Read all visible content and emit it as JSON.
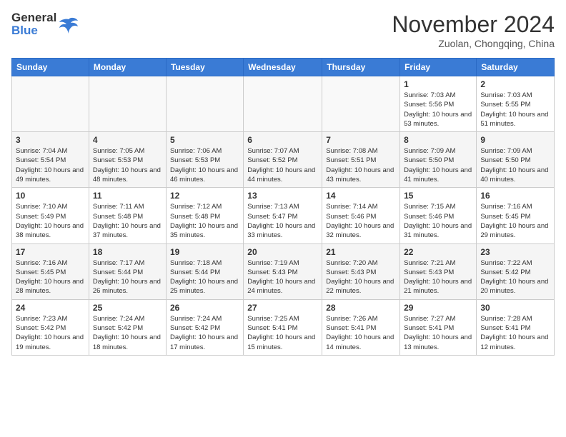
{
  "header": {
    "logo_line1": "General",
    "logo_line2": "Blue",
    "month": "November 2024",
    "location": "Zuolan, Chongqing, China"
  },
  "weekdays": [
    "Sunday",
    "Monday",
    "Tuesday",
    "Wednesday",
    "Thursday",
    "Friday",
    "Saturday"
  ],
  "weeks": [
    [
      {
        "day": "",
        "info": ""
      },
      {
        "day": "",
        "info": ""
      },
      {
        "day": "",
        "info": ""
      },
      {
        "day": "",
        "info": ""
      },
      {
        "day": "",
        "info": ""
      },
      {
        "day": "1",
        "info": "Sunrise: 7:03 AM\nSunset: 5:56 PM\nDaylight: 10 hours and 53 minutes."
      },
      {
        "day": "2",
        "info": "Sunrise: 7:03 AM\nSunset: 5:55 PM\nDaylight: 10 hours and 51 minutes."
      }
    ],
    [
      {
        "day": "3",
        "info": "Sunrise: 7:04 AM\nSunset: 5:54 PM\nDaylight: 10 hours and 49 minutes."
      },
      {
        "day": "4",
        "info": "Sunrise: 7:05 AM\nSunset: 5:53 PM\nDaylight: 10 hours and 48 minutes."
      },
      {
        "day": "5",
        "info": "Sunrise: 7:06 AM\nSunset: 5:53 PM\nDaylight: 10 hours and 46 minutes."
      },
      {
        "day": "6",
        "info": "Sunrise: 7:07 AM\nSunset: 5:52 PM\nDaylight: 10 hours and 44 minutes."
      },
      {
        "day": "7",
        "info": "Sunrise: 7:08 AM\nSunset: 5:51 PM\nDaylight: 10 hours and 43 minutes."
      },
      {
        "day": "8",
        "info": "Sunrise: 7:09 AM\nSunset: 5:50 PM\nDaylight: 10 hours and 41 minutes."
      },
      {
        "day": "9",
        "info": "Sunrise: 7:09 AM\nSunset: 5:50 PM\nDaylight: 10 hours and 40 minutes."
      }
    ],
    [
      {
        "day": "10",
        "info": "Sunrise: 7:10 AM\nSunset: 5:49 PM\nDaylight: 10 hours and 38 minutes."
      },
      {
        "day": "11",
        "info": "Sunrise: 7:11 AM\nSunset: 5:48 PM\nDaylight: 10 hours and 37 minutes."
      },
      {
        "day": "12",
        "info": "Sunrise: 7:12 AM\nSunset: 5:48 PM\nDaylight: 10 hours and 35 minutes."
      },
      {
        "day": "13",
        "info": "Sunrise: 7:13 AM\nSunset: 5:47 PM\nDaylight: 10 hours and 33 minutes."
      },
      {
        "day": "14",
        "info": "Sunrise: 7:14 AM\nSunset: 5:46 PM\nDaylight: 10 hours and 32 minutes."
      },
      {
        "day": "15",
        "info": "Sunrise: 7:15 AM\nSunset: 5:46 PM\nDaylight: 10 hours and 31 minutes."
      },
      {
        "day": "16",
        "info": "Sunrise: 7:16 AM\nSunset: 5:45 PM\nDaylight: 10 hours and 29 minutes."
      }
    ],
    [
      {
        "day": "17",
        "info": "Sunrise: 7:16 AM\nSunset: 5:45 PM\nDaylight: 10 hours and 28 minutes."
      },
      {
        "day": "18",
        "info": "Sunrise: 7:17 AM\nSunset: 5:44 PM\nDaylight: 10 hours and 26 minutes."
      },
      {
        "day": "19",
        "info": "Sunrise: 7:18 AM\nSunset: 5:44 PM\nDaylight: 10 hours and 25 minutes."
      },
      {
        "day": "20",
        "info": "Sunrise: 7:19 AM\nSunset: 5:43 PM\nDaylight: 10 hours and 24 minutes."
      },
      {
        "day": "21",
        "info": "Sunrise: 7:20 AM\nSunset: 5:43 PM\nDaylight: 10 hours and 22 minutes."
      },
      {
        "day": "22",
        "info": "Sunrise: 7:21 AM\nSunset: 5:43 PM\nDaylight: 10 hours and 21 minutes."
      },
      {
        "day": "23",
        "info": "Sunrise: 7:22 AM\nSunset: 5:42 PM\nDaylight: 10 hours and 20 minutes."
      }
    ],
    [
      {
        "day": "24",
        "info": "Sunrise: 7:23 AM\nSunset: 5:42 PM\nDaylight: 10 hours and 19 minutes."
      },
      {
        "day": "25",
        "info": "Sunrise: 7:24 AM\nSunset: 5:42 PM\nDaylight: 10 hours and 18 minutes."
      },
      {
        "day": "26",
        "info": "Sunrise: 7:24 AM\nSunset: 5:42 PM\nDaylight: 10 hours and 17 minutes."
      },
      {
        "day": "27",
        "info": "Sunrise: 7:25 AM\nSunset: 5:41 PM\nDaylight: 10 hours and 15 minutes."
      },
      {
        "day": "28",
        "info": "Sunrise: 7:26 AM\nSunset: 5:41 PM\nDaylight: 10 hours and 14 minutes."
      },
      {
        "day": "29",
        "info": "Sunrise: 7:27 AM\nSunset: 5:41 PM\nDaylight: 10 hours and 13 minutes."
      },
      {
        "day": "30",
        "info": "Sunrise: 7:28 AM\nSunset: 5:41 PM\nDaylight: 10 hours and 12 minutes."
      }
    ]
  ]
}
